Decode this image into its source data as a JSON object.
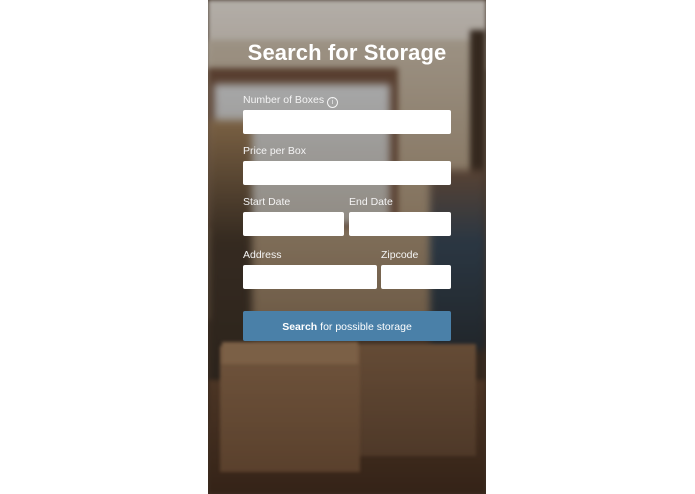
{
  "form": {
    "title": "Search for Storage",
    "number_of_boxes": {
      "label": "Number of Boxes",
      "value": "",
      "info_icon": "info-icon"
    },
    "price_per_box": {
      "label": "Price per Box",
      "value": ""
    },
    "start_date": {
      "label": "Start Date",
      "value": ""
    },
    "end_date": {
      "label": "End Date",
      "value": ""
    },
    "address": {
      "label": "Address",
      "value": ""
    },
    "zipcode": {
      "label": "Zipcode",
      "value": ""
    },
    "submit": {
      "bold": "Search",
      "rest": "for possible storage"
    }
  },
  "colors": {
    "button": "#4a80a8",
    "text": "#ffffff",
    "field": "#ffffff"
  }
}
